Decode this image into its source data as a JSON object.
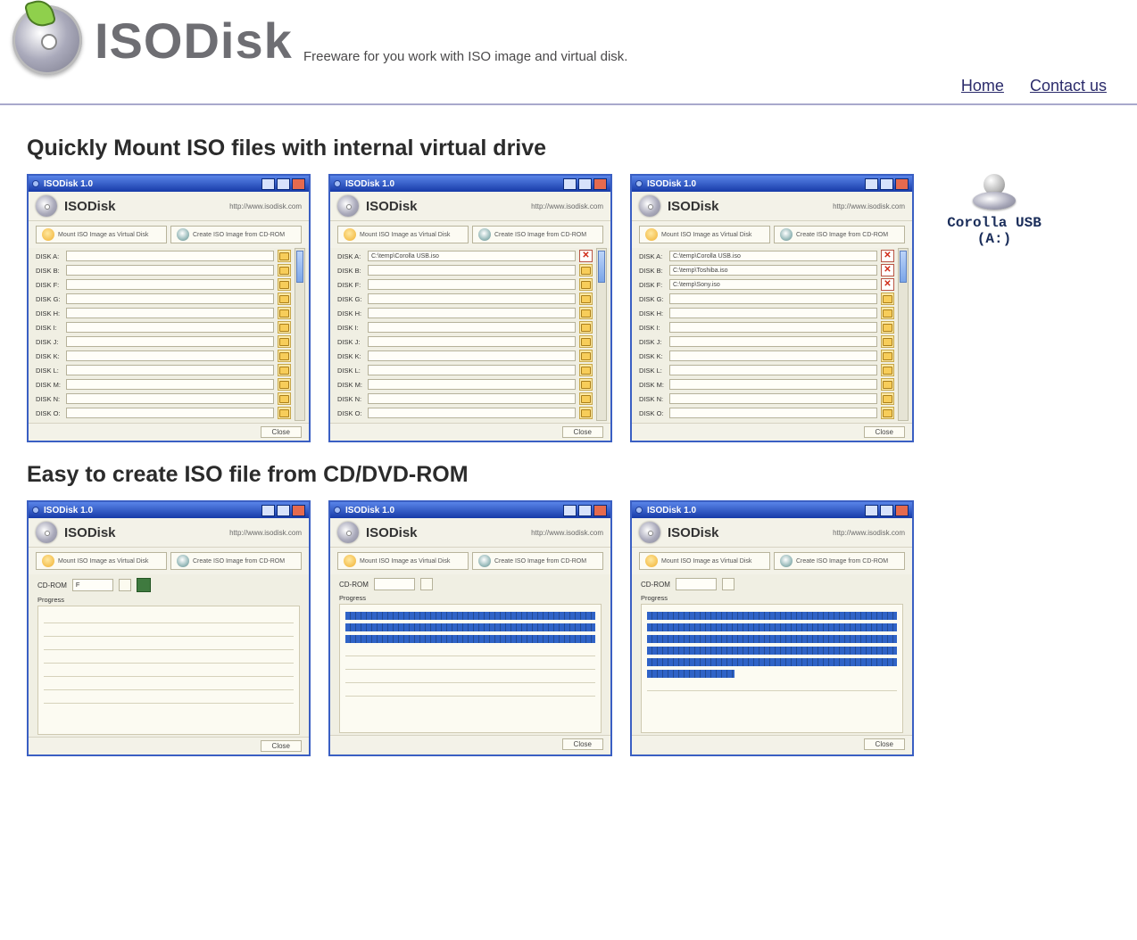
{
  "header": {
    "site_title": "ISODisk",
    "tagline": "Freeware for you work with ISO image and virtual disk.",
    "nav": {
      "home": "Home",
      "contact": "Contact us"
    }
  },
  "section1": {
    "title": "Quickly Mount ISO files with internal virtual drive"
  },
  "section2": {
    "title": "Easy to create ISO file from CD/DVD-ROM"
  },
  "app": {
    "titlebar": "ISODisk 1.0",
    "name": "ISODisk",
    "url": "http://www.isodisk.com",
    "tab_mount": "Mount ISO Image as Virtual Disk",
    "tab_create": "Create ISO Image from CD-ROM",
    "close_label": "Close",
    "cd_rom_label": "CD-ROM",
    "progress_label": "Progress"
  },
  "drive_letters": [
    "A",
    "B",
    "F",
    "G",
    "H",
    "I",
    "J",
    "K",
    "L",
    "M",
    "N",
    "O"
  ],
  "mount_shots": [
    {
      "filled": [
        {
          "index": 0,
          "path": "",
          "clear": false
        },
        {
          "index": 1,
          "path": "",
          "clear": false
        },
        {
          "index": 2,
          "path": "",
          "clear": false
        }
      ]
    },
    {
      "filled": [
        {
          "index": 0,
          "path": "C:\\temp\\Corolla USB.iso",
          "clear": true
        },
        {
          "index": 1,
          "path": "",
          "clear": false
        },
        {
          "index": 2,
          "path": "",
          "clear": false
        }
      ]
    },
    {
      "filled": [
        {
          "index": 0,
          "path": "C:\\temp\\Corolla USB.iso",
          "clear": true
        },
        {
          "index": 1,
          "path": "C:\\temp\\Toshiba.iso",
          "clear": true
        },
        {
          "index": 2,
          "path": "C:\\temp\\Sony.iso",
          "clear": true
        }
      ]
    }
  ],
  "create_shots": [
    {
      "progress_lines": 0,
      "selected_drive": "F",
      "has_save": true
    },
    {
      "progress_lines": 3,
      "selected_drive": "",
      "has_save": false
    },
    {
      "progress_lines": 6,
      "selected_drive": "",
      "has_save": false,
      "last_line_frac": 0.35
    }
  ],
  "usb": {
    "label_1": "Corolla USB",
    "label_2": "(A:)"
  }
}
